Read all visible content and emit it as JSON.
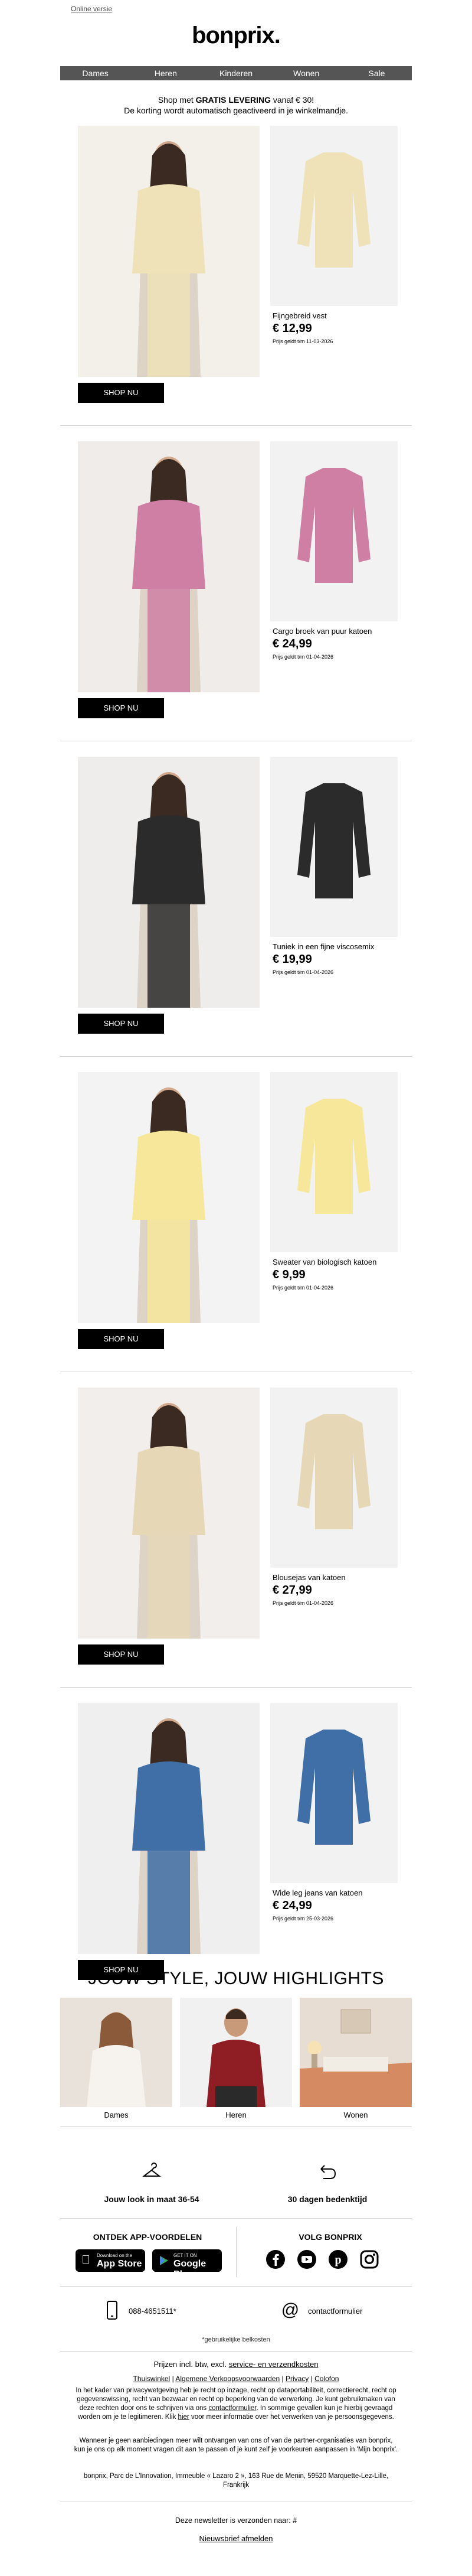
{
  "header": {
    "online_link": "Online versie",
    "logo": "bonprix.",
    "nav": [
      "Dames",
      "Heren",
      "Kinderen",
      "Wonen",
      "Sale"
    ]
  },
  "shipping": {
    "prefix": "Shop met ",
    "bold": "GRATIS LEVERING",
    "suffix": " vanaf € 30!",
    "line2": "De korting wordt automatisch geactiveerd in je winkelmandje."
  },
  "shop_button": "SHOP NU",
  "products": [
    {
      "name": "Fijngebreid vest",
      "price": "€ 12,99",
      "date": "Prijs geldt t/m 11-03-2026",
      "model_bg": "#f3efe9",
      "thumb_bg": "#f2f2f2",
      "color": "#efe2b8"
    },
    {
      "name": "Cargo broek van puur katoen",
      "price": "€ 24,99",
      "date": "Prijs geldt t/m 01-04-2026",
      "model_bg": "#f0ecea",
      "thumb_bg": "#f2f2f2",
      "color": "#cf7fa4"
    },
    {
      "name": "Tuniek in een fijne viscosemix",
      "price": "€ 19,99",
      "date": "Prijs geldt t/m 01-04-2026",
      "model_bg": "#efedeb",
      "thumb_bg": "#f2f2f2",
      "color": "#2b2b2b"
    },
    {
      "name": "Sweater van biologisch katoen",
      "price": "€ 9,99",
      "date": "Prijs geldt t/m 01-04-2026",
      "model_bg": "#f3f3f3",
      "thumb_bg": "#f2f2f2",
      "color": "#f7e79a"
    },
    {
      "name": "Blousejas van katoen",
      "price": "€ 27,99",
      "date": "Prijs geldt t/m 01-04-2026",
      "model_bg": "#f1eeeb",
      "thumb_bg": "#f2f2f2",
      "color": "#e6d7b6"
    },
    {
      "name": "Wide leg jeans van katoen",
      "price": "€ 24,99",
      "date": "Prijs geldt t/m 25-03-2026",
      "model_bg": "#efefef",
      "thumb_bg": "#f2f2f2",
      "color": "#3f6fa6"
    }
  ],
  "highlights": {
    "title": "JOUW STYLE, JOUW HIGHLIGHTS",
    "items": [
      "Dames",
      "Heren",
      "Wonen"
    ]
  },
  "features": {
    "left": "Jouw look in maat 36-54",
    "right": "30 dagen bedenktijd"
  },
  "apps": {
    "title": "ONTDEK APP-VOORDELEN",
    "appstore_small": "Download on the",
    "appstore": "App Store",
    "google_small": "GET IT ON",
    "google": "Google Play"
  },
  "social": {
    "title": "VOLG BONPRIX",
    "icons": [
      "facebook-icon",
      "youtube-icon",
      "pinterest-icon",
      "instagram-icon"
    ]
  },
  "contact": {
    "phone": "088-4651511*",
    "form": "contactformulier",
    "note": "*gebruikelijke belkosten"
  },
  "footer": {
    "prices": "Prijzen incl. btw, excl. ",
    "prices_link": "service- en verzendkosten",
    "links": [
      "Thuiswinkel",
      "Algemene Verkoopsvoorwaarden",
      "Privacy",
      "Colofon"
    ],
    "privacy_text": "In het kader van privacywetgeving heb je recht op inzage, recht op dataportabiliteit, correctierecht, recht op gegevenswissing, recht van bezwaar en recht op beperking van de verwerking. Je kunt gebruikmaken van deze rechten door ons te schrijven via ons",
    "contact_link": "contactformulier",
    "privacy_text2": ". In sommige gevallen kun je hierbij gevraagd worden om je te legitimeren. Klik",
    "hier": "hier",
    "privacy_text3": "voor meer informatie over het verwerken van je persoonsgegevens.",
    "offers_text": "Wanneer je geen aanbiedingen meer wilt ontvangen van ons of van de partner-organisaties van bonprix, kun je ons op elk moment vragen dit aan te passen of je kunt zelf je voorkeuren aanpassen in 'Mijn bonprix'.",
    "address": "bonprix, Parc de L'Innovation, Immeuble « Lazaro 2 », 163 Rue de Menin, 59520 Marquette-Lez-Lille, Frankrijk",
    "sent_to": "Deze newsletter is verzonden naar: #",
    "unsubscribe": "Nieuwsbrief afmelden"
  }
}
